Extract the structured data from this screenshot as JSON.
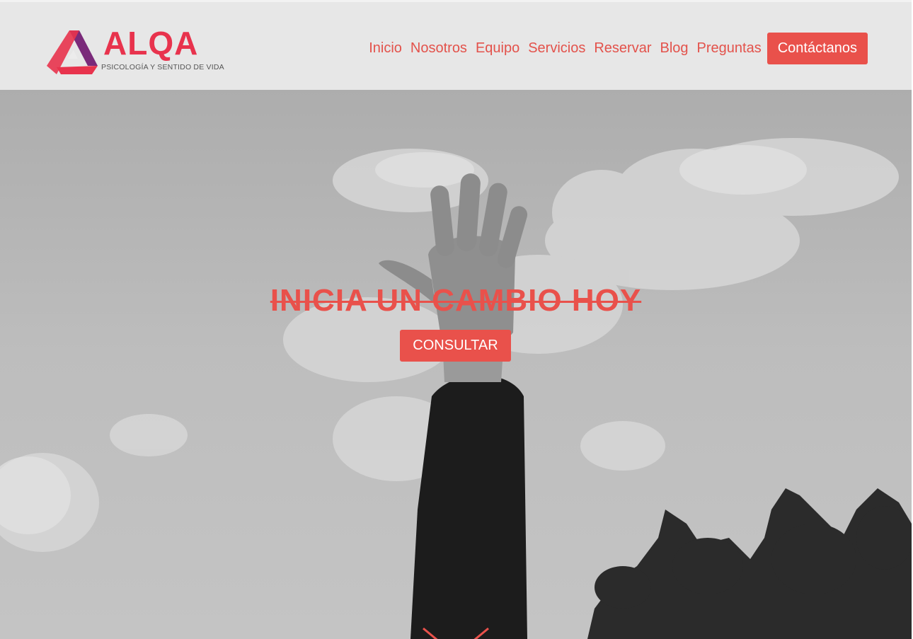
{
  "brand": {
    "name": "ALQA",
    "tagline": "PSICOLOGÍA Y SENTIDO DE VIDA",
    "color_primary": "#e8334d",
    "color_secondary": "#7a2a7a"
  },
  "nav": {
    "items": [
      {
        "label": "Inicio"
      },
      {
        "label": "Nosotros"
      },
      {
        "label": "Equipo"
      },
      {
        "label": "Servicios"
      },
      {
        "label": "Reservar"
      },
      {
        "label": "Blog"
      },
      {
        "label": "Preguntas"
      }
    ],
    "contact_label": "Contáctanos",
    "link_color": "#e3524b",
    "button_color": "#e9514b"
  },
  "hero": {
    "title": "INICIA UN CAMBIO HOY",
    "cta_label": "CONSULTAR",
    "scroll_icon": "chevron-down-icon"
  }
}
